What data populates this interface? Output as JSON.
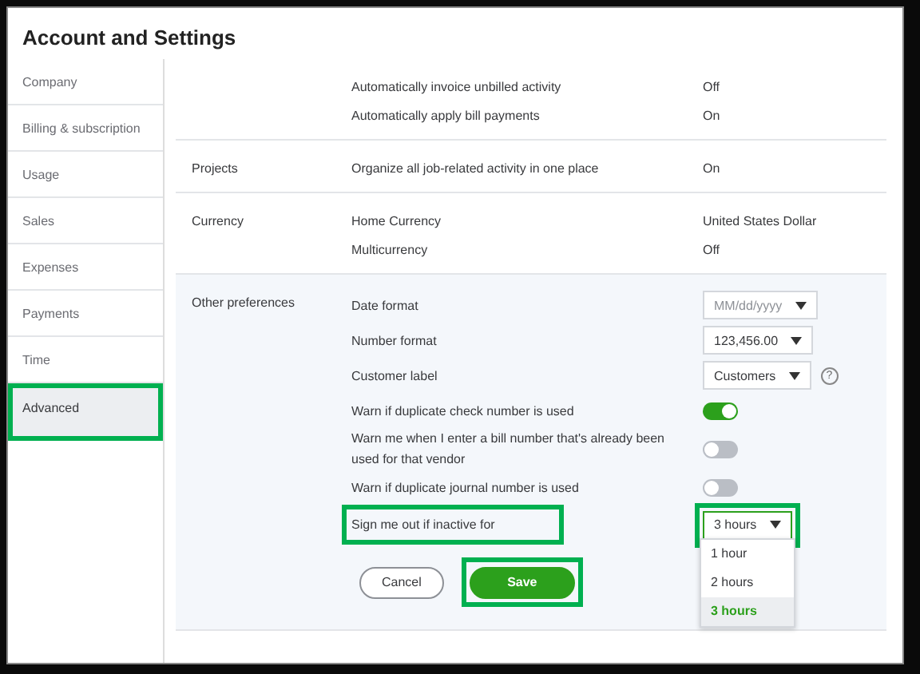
{
  "window": {
    "title": "Account and Settings"
  },
  "sidebar": {
    "items": [
      {
        "label": "Company",
        "selected": false,
        "highlighted": false
      },
      {
        "label": "Billing & subscription",
        "selected": false,
        "highlighted": false
      },
      {
        "label": "Usage",
        "selected": false,
        "highlighted": false
      },
      {
        "label": "Sales",
        "selected": false,
        "highlighted": false
      },
      {
        "label": "Expenses",
        "selected": false,
        "highlighted": false
      },
      {
        "label": "Payments",
        "selected": false,
        "highlighted": false
      },
      {
        "label": "Time",
        "selected": false,
        "highlighted": false
      },
      {
        "label": "Advanced",
        "selected": true,
        "highlighted": true
      }
    ]
  },
  "sections": [
    {
      "rows": [
        {
          "kind": "text",
          "label": "Automatically invoice unbilled activity",
          "value": "Off"
        },
        {
          "kind": "text",
          "label": "Automatically apply bill payments",
          "value": "On"
        }
      ]
    },
    {
      "label": "Projects",
      "rows": [
        {
          "kind": "text",
          "label": "Organize all job-related activity in one place",
          "value": "On"
        }
      ]
    },
    {
      "label": "Currency",
      "rows": [
        {
          "kind": "text",
          "label": "Home Currency",
          "value": "United States Dollar"
        },
        {
          "kind": "text",
          "label": "Multicurrency",
          "value": "Off"
        }
      ]
    },
    {
      "label": "Other preferences",
      "editing": true,
      "rows": [
        {
          "kind": "select",
          "label": "Date format",
          "placeholder": "MM/dd/yyyy"
        },
        {
          "kind": "select",
          "label": "Number format",
          "value": "123,456.00"
        },
        {
          "kind": "select",
          "label": "Customer label",
          "value": "Customers",
          "help": "?"
        },
        {
          "kind": "toggle",
          "label": "Warn if duplicate check number is used",
          "on": true
        },
        {
          "kind": "toggle",
          "label": "Warn me when I enter a bill number that's already been used for that vendor",
          "on": false
        },
        {
          "kind": "toggle",
          "label": "Warn if duplicate journal number is used",
          "on": false
        },
        {
          "kind": "select",
          "label": "Sign me out if inactive for",
          "value": "3 hours",
          "highlighted": true,
          "expanded": true,
          "options": [
            {
              "label": "1 hour",
              "selected": false
            },
            {
              "label": "2 hours",
              "selected": false
            },
            {
              "label": "3 hours",
              "selected": true
            }
          ]
        }
      ],
      "buttons": [
        {
          "kind": "secondary",
          "label": "Cancel",
          "highlighted": false
        },
        {
          "kind": "primary",
          "label": "Save",
          "highlighted": true
        }
      ]
    }
  ]
}
